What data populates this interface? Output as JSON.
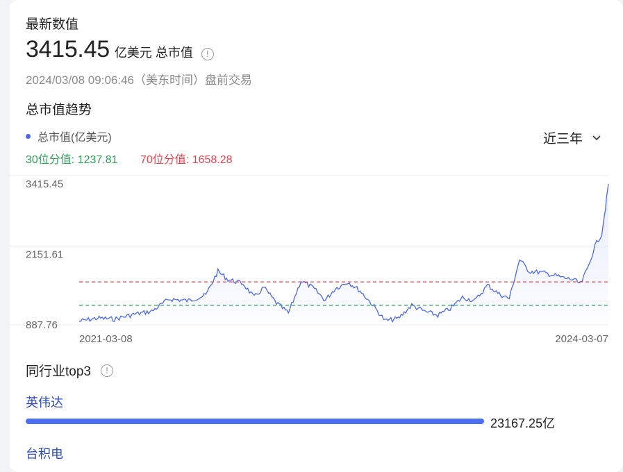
{
  "colors": {
    "line": "#4b68e8",
    "p30": "#2e9e58",
    "p70": "#e8424f",
    "peer_name": "#2d4bc0",
    "bar": "#4d6ff2"
  },
  "latest": {
    "heading": "最新数值",
    "value": "3415.45",
    "unit": "亿美元 总市值",
    "info_icon": "info-circle-icon",
    "timestamp": "2024/03/08 09:06:46（美东时间）盘前交易"
  },
  "trend": {
    "heading": "总市值趋势",
    "legend_label": "总市值(亿美元)",
    "range_label": "近三年",
    "range_icon": "chevron-down-icon",
    "p30_label": "30位分值: 1237.81",
    "p70_label": "70位分值: 1658.28"
  },
  "chart_data": {
    "type": "line",
    "series": [
      {
        "name": "总市值(亿美元)"
      }
    ],
    "x_start": "2021-03-08",
    "x_end": "2024-03-07",
    "x_tick_labels": [
      "2021-03-08",
      "2024-03-07"
    ],
    "y_tick_labels": [
      "3415.45",
      "2151.61",
      "887.76"
    ],
    "ylim": [
      887.76,
      3415.45
    ],
    "reference_lines": [
      {
        "label": "30位分值",
        "value": 1237.81
      },
      {
        "label": "70位分值",
        "value": 1658.28
      }
    ],
    "points": [
      [
        "2021-03-08",
        950
      ],
      [
        "2021-04-15",
        1010
      ],
      [
        "2021-05-20",
        990
      ],
      [
        "2021-07-01",
        1080
      ],
      [
        "2021-08-05",
        1130
      ],
      [
        "2021-09-10",
        1350
      ],
      [
        "2021-10-20",
        1320
      ],
      [
        "2021-11-25",
        1420
      ],
      [
        "2021-12-20",
        1850
      ],
      [
        "2022-01-10",
        1700
      ],
      [
        "2022-02-10",
        1630
      ],
      [
        "2022-03-05",
        1380
      ],
      [
        "2022-03-25",
        1560
      ],
      [
        "2022-04-20",
        1280
      ],
      [
        "2022-05-15",
        1100
      ],
      [
        "2022-06-10",
        1680
      ],
      [
        "2022-07-05",
        1550
      ],
      [
        "2022-07-30",
        1330
      ],
      [
        "2022-08-20",
        1540
      ],
      [
        "2022-09-15",
        1660
      ],
      [
        "2022-10-10",
        1500
      ],
      [
        "2022-11-05",
        1250
      ],
      [
        "2022-12-01",
        960
      ],
      [
        "2022-12-28",
        1000
      ],
      [
        "2023-01-25",
        1240
      ],
      [
        "2023-02-20",
        1130
      ],
      [
        "2023-03-20",
        1060
      ],
      [
        "2023-04-15",
        1180
      ],
      [
        "2023-05-10",
        1380
      ],
      [
        "2023-06-05",
        1320
      ],
      [
        "2023-07-01",
        1600
      ],
      [
        "2023-07-25",
        1440
      ],
      [
        "2023-08-15",
        1360
      ],
      [
        "2023-09-05",
        2060
      ],
      [
        "2023-09-25",
        1850
      ],
      [
        "2023-10-20",
        1830
      ],
      [
        "2023-11-15",
        1780
      ],
      [
        "2023-12-05",
        1730
      ],
      [
        "2023-12-25",
        1700
      ],
      [
        "2024-01-10",
        1620
      ],
      [
        "2024-01-25",
        1930
      ],
      [
        "2024-02-08",
        2300
      ],
      [
        "2024-02-22",
        2520
      ],
      [
        "2024-03-01",
        3000
      ],
      [
        "2024-03-07",
        3415.45
      ]
    ]
  },
  "peers": {
    "heading": "同行业top3",
    "info_icon": "info-circle-icon",
    "items": [
      {
        "name": "英伟达",
        "value_label": "23167.25亿",
        "value": 23167.25
      },
      {
        "name": "台积电",
        "value_label": "",
        "value": null
      }
    ]
  }
}
